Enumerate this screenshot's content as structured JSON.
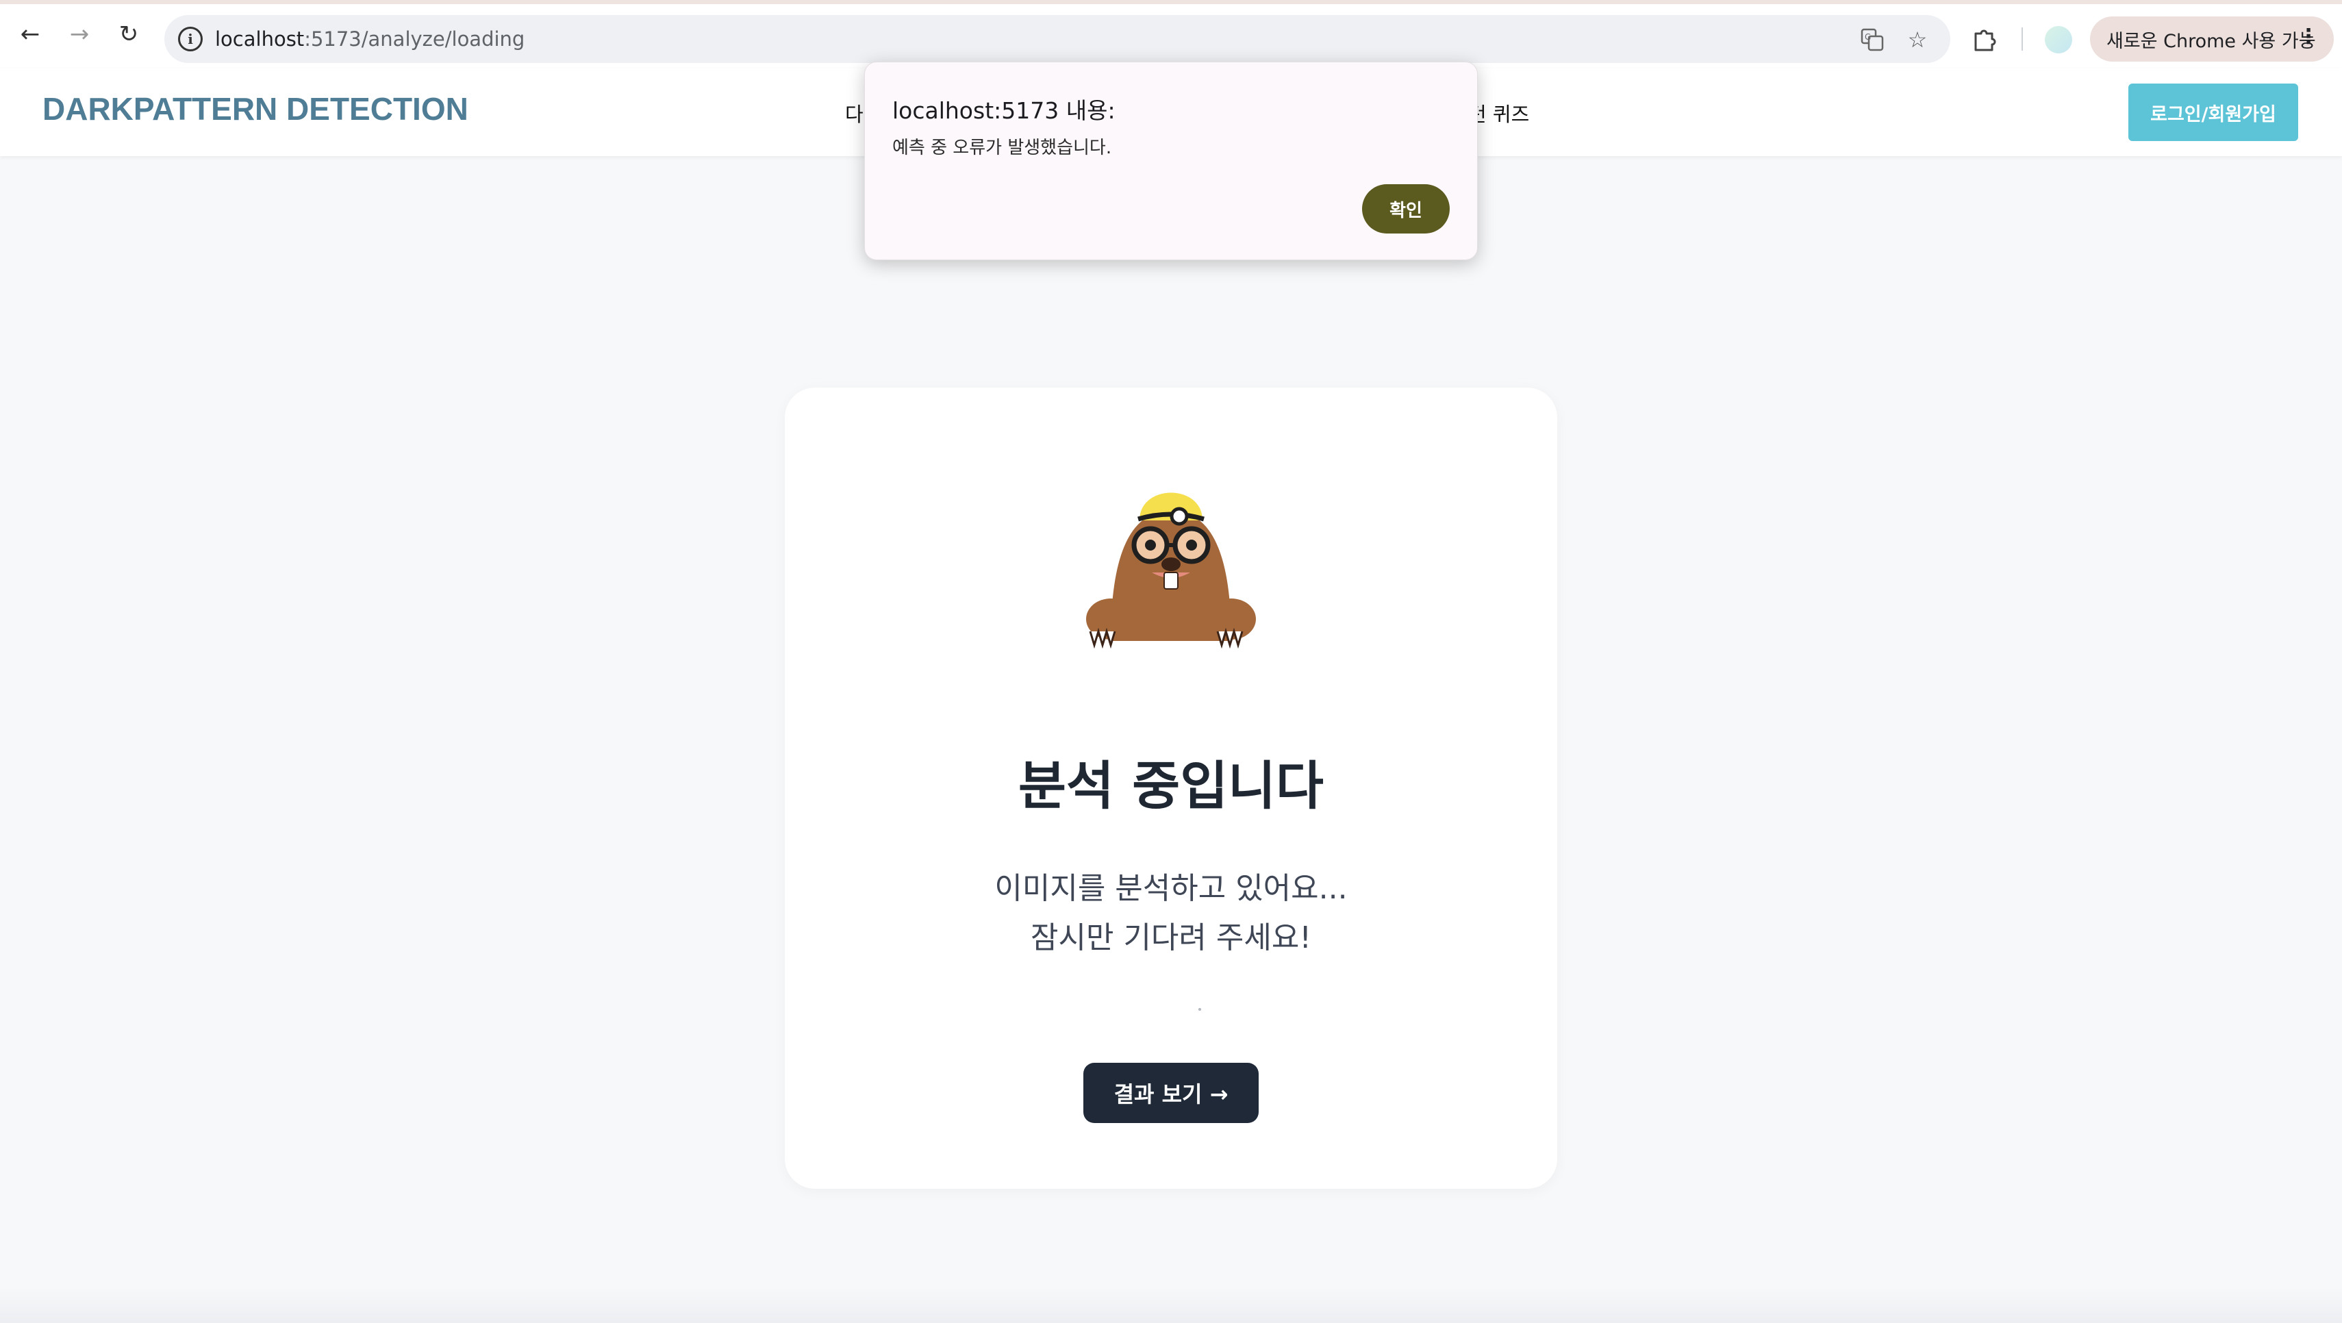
{
  "browser": {
    "url_host": "localhost",
    "url_rest": ":5173/analyze/loading",
    "update_button": "새로운 Chrome 사용 가능",
    "icons": [
      "back-icon",
      "forward-icon",
      "reload-icon",
      "site-info-icon",
      "translate-icon",
      "bookmark-star-icon",
      "extensions-icon",
      "profile-avatar",
      "more-menu-icon"
    ]
  },
  "header": {
    "logo": "DARKPATTERN DETECTION",
    "menu_left_partial": "다",
    "menu_right_partial": "턴 퀴즈",
    "login_button": "로그인/회원가입"
  },
  "card": {
    "title": "분석 중입니다",
    "desc_line1": "이미지를 분석하고 있어요...",
    "desc_line2": "잠시만 기다려 주세요!",
    "result_button": "결과 보기 →"
  },
  "dialog": {
    "title": "localhost:5173 내용:",
    "message": "예측 중 오류가 발생했습니다.",
    "ok_button": "확인"
  },
  "colors": {
    "logo": "#4f7d95",
    "login_button": "#5cc4d6",
    "result_button": "#1f2937",
    "dialog_ok": "#5b5a1f",
    "page_bg": "#f7f8fa"
  }
}
